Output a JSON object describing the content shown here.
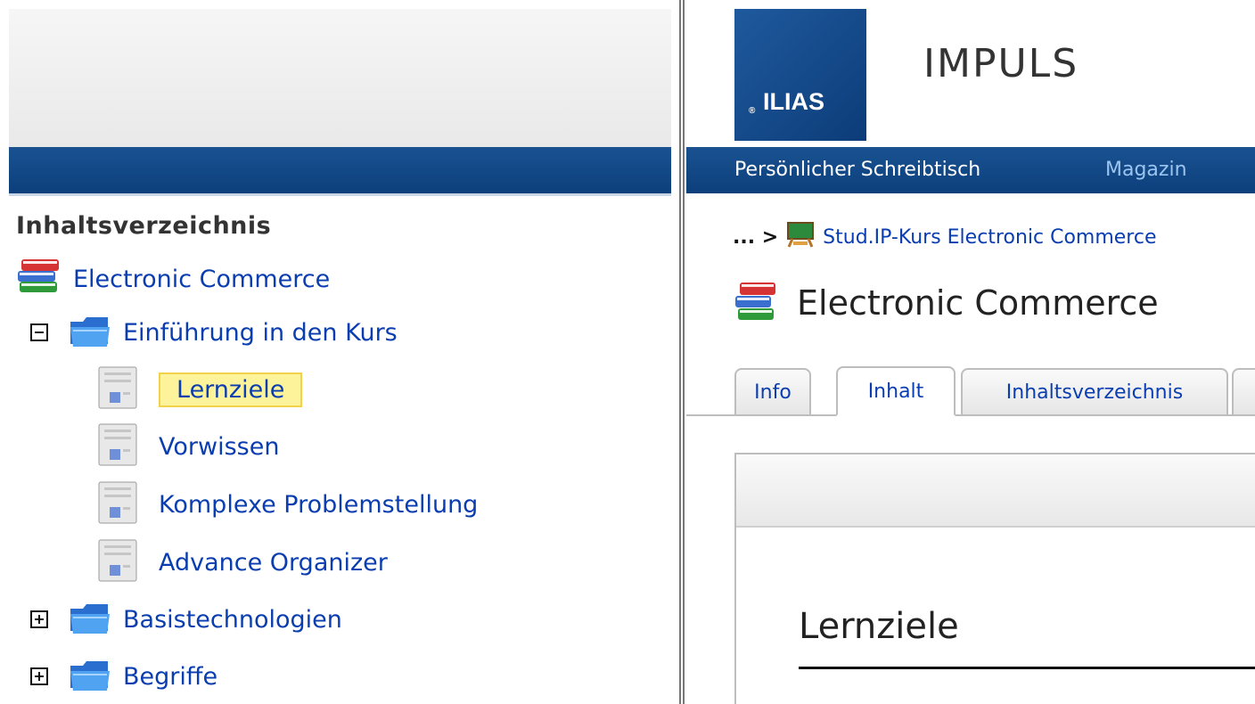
{
  "toc": {
    "title": "Inhaltsverzeichnis",
    "root": {
      "label": "Electronic Commerce",
      "icon": "books-icon"
    },
    "chapters": [
      {
        "label": "Einführung in den Kurs",
        "expanded": true,
        "icon": "folder-icon",
        "pages": [
          {
            "label": "Lernziele",
            "selected": true,
            "icon": "page-icon"
          },
          {
            "label": "Vorwissen",
            "icon": "page-icon"
          },
          {
            "label": "Komplexe Problemstellung",
            "icon": "page-icon"
          },
          {
            "label": "Advance Organizer",
            "icon": "page-icon"
          }
        ]
      },
      {
        "label": "Basistechnologien",
        "expanded": false,
        "icon": "folder-icon"
      },
      {
        "label": "Begriffe",
        "expanded": false,
        "icon": "folder-icon"
      }
    ]
  },
  "header": {
    "logo": "ILIAS",
    "logo_mark": "®",
    "installation": "IMPULS"
  },
  "nav": {
    "items": [
      {
        "label": "Persönlicher Schreibtisch",
        "color": "#ffffff"
      },
      {
        "label": "Magazin",
        "color": "#9cc4f0"
      }
    ]
  },
  "breadcrumb": {
    "prefix": "... >",
    "item": "Stud.IP-Kurs Electronic Commerce",
    "icon": "course-icon"
  },
  "page": {
    "title": "Electronic Commerce",
    "icon": "books-icon",
    "tabs": [
      {
        "label": "Info",
        "active": false
      },
      {
        "label": "Inhalt",
        "active": true
      },
      {
        "label": "Inhaltsverzeichnis",
        "active": false
      }
    ],
    "content_heading": "Lernziele"
  },
  "colors": {
    "brand_blue": "#0c3f7c",
    "link": "#0a3db0",
    "highlight": "#fdf39a"
  }
}
